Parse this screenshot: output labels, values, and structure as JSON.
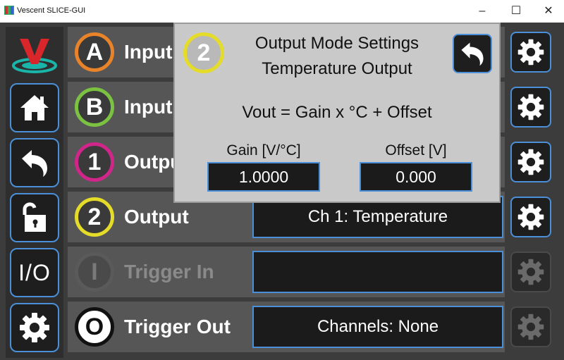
{
  "window": {
    "title": "Vescent SLICE-GUI",
    "minimize": "–",
    "maximize": "☐",
    "close": "✕"
  },
  "sidebar": {
    "io_label": "I/O"
  },
  "rows": [
    {
      "badge": "A",
      "label": "Input",
      "value": "",
      "badge_color": "#e8832a"
    },
    {
      "badge": "B",
      "label": "Input",
      "value": "",
      "badge_color": "#7cc242"
    },
    {
      "badge": "1",
      "label": "Output",
      "value": "",
      "badge_color": "#d0268a"
    },
    {
      "badge": "2",
      "label": "Output",
      "value": "Ch 1: Temperature",
      "badge_color": "#e5dc2a"
    },
    {
      "badge": "I",
      "label": "Trigger In",
      "value": "",
      "badge_color": "#5a5a5a"
    },
    {
      "badge": "O",
      "label": "Trigger Out",
      "value": "Channels: None",
      "badge_color": "#111111"
    }
  ],
  "popup": {
    "badge": "2",
    "title_line1": "Output Mode Settings",
    "title_line2": "Temperature Output",
    "formula": "Vout = Gain x °C + Offset",
    "gain_label": "Gain [V/°C]",
    "gain_value": "1.0000",
    "offset_label": "Offset [V]",
    "offset_value": "0.000"
  },
  "colors": {
    "accent": "#4a8fd8",
    "background": "#3c3c3c",
    "row": "#565656",
    "popup": "#c9c9c9"
  }
}
